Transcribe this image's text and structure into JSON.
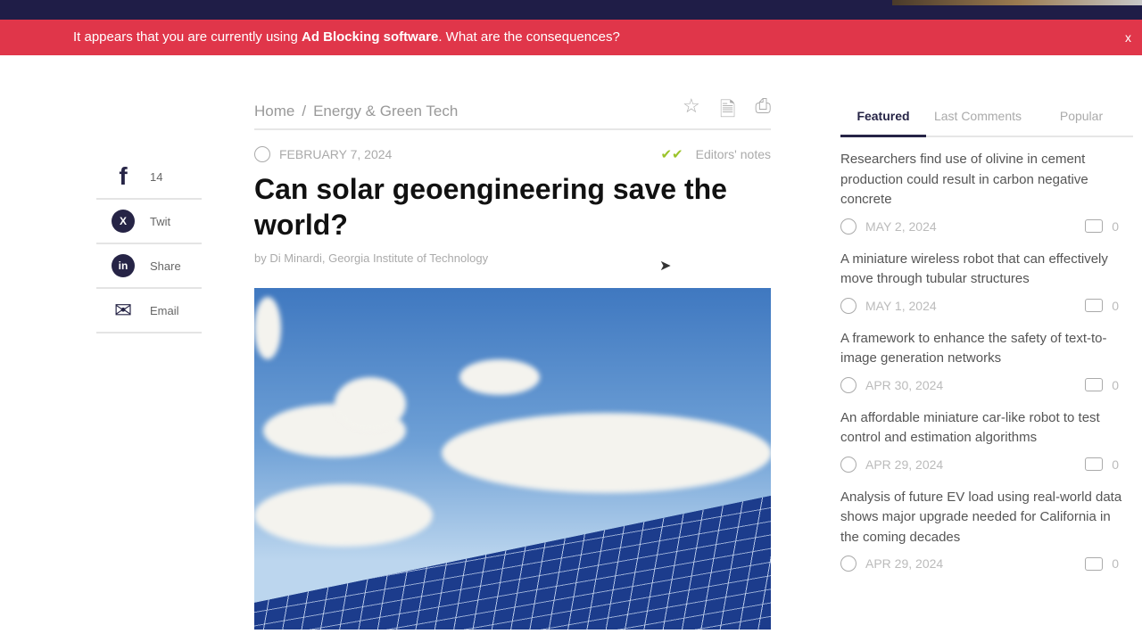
{
  "adbar": {
    "prefix": "It appears that you are currently using ",
    "bold": "Ad Blocking software",
    "suffix": ". What are the consequences?",
    "close": "x"
  },
  "share": [
    {
      "icon": "facebook-icon",
      "glyph": "f",
      "label": "14"
    },
    {
      "icon": "x-icon",
      "glyph": "X",
      "label": "Twit"
    },
    {
      "icon": "linkedin-icon",
      "glyph": "in",
      "label": "Share"
    },
    {
      "icon": "email-icon",
      "glyph": "✉",
      "label": "Email"
    }
  ],
  "breadcrumb": {
    "home": "Home",
    "sep": "/",
    "category": "Energy & Green Tech"
  },
  "article": {
    "date": "FEBRUARY 7, 2024",
    "editors": "Editors' notes",
    "title": "Can solar geoengineering save the world?",
    "byline": "by Di Minardi, Georgia Institute of Technology"
  },
  "sidebar": {
    "tabs": [
      "Featured",
      "Last Comments",
      "Popular"
    ],
    "articles": [
      {
        "title": "Researchers find use of olivine in cement production could result in carbon negative concrete",
        "date": "MAY 2, 2024",
        "comments": "0"
      },
      {
        "title": "A miniature wireless robot that can effectively move through tubular structures",
        "date": "MAY 1, 2024",
        "comments": "0"
      },
      {
        "title": "A framework to enhance the safety of text-to-image generation networks",
        "date": "APR 30, 2024",
        "comments": "0"
      },
      {
        "title": "An affordable miniature car-like robot to test control and estimation algorithms",
        "date": "APR 29, 2024",
        "comments": "0"
      },
      {
        "title": "Analysis of future EV load using real-world data shows major upgrade needed for California in the coming decades",
        "date": "APR 29, 2024",
        "comments": "0"
      }
    ]
  }
}
